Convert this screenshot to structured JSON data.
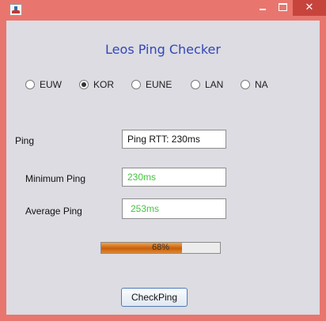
{
  "window": {
    "title": ""
  },
  "app_title": "Leos Ping Checker",
  "servers": [
    {
      "label": "EUW",
      "checked": false
    },
    {
      "label": "KOR",
      "checked": true
    },
    {
      "label": "EUNE",
      "checked": false
    },
    {
      "label": "LAN",
      "checked": false
    },
    {
      "label": "NA",
      "checked": false
    }
  ],
  "ping": {
    "label": "Ping",
    "value": "Ping RTT: 230ms"
  },
  "min_ping": {
    "label": "Minimum Ping",
    "value": "230ms"
  },
  "avg_ping": {
    "label": "Average Ping",
    "value": "253ms"
  },
  "progress": {
    "percent": 68,
    "text": "68%"
  },
  "check_button": {
    "label": "CheckPing"
  },
  "colors": {
    "titlebar": "#e8766f",
    "close_button": "#c7443d",
    "client_bg": "#dcdce2",
    "title_text": "#3346b9",
    "ping_value_text": "#44c53f",
    "progress_fill": "#d9731a"
  }
}
